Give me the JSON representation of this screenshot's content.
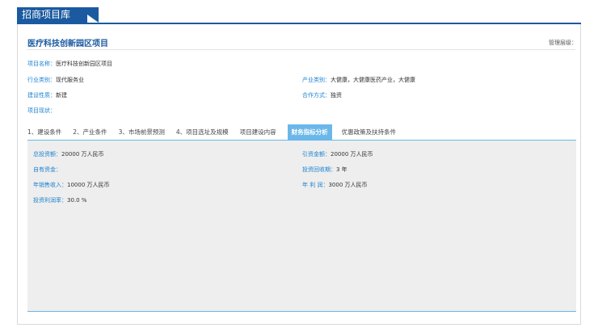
{
  "header": {
    "title": "招商项目库"
  },
  "project": {
    "title": "医疗科技创新园区项目",
    "management_label": "管理层级："
  },
  "fields": {
    "name": {
      "label": "项目名称：",
      "value": "医疗科技创新园区项目"
    },
    "industry": {
      "label": "行业类别：",
      "value": "现代服务业"
    },
    "product": {
      "label": "产业类别：",
      "value": "大健康，大健康医药产业，大健康"
    },
    "nature": {
      "label": "建设性质：",
      "value": "新建"
    },
    "coop": {
      "label": "合作方式：",
      "value": "独资"
    },
    "status": {
      "label": "项目现状：",
      "value": ""
    }
  },
  "tabs": [
    {
      "label": "1、建设条件"
    },
    {
      "label": "2、产业条件"
    },
    {
      "label": "3、市场前景预测"
    },
    {
      "label": "4、项目选址及规模"
    },
    {
      "label": "项目建设内容"
    },
    {
      "label": "财务指标分析",
      "active": true
    },
    {
      "label": "优惠政策及扶持条件"
    }
  ],
  "finance": {
    "total_investment": {
      "label": "总投资额：",
      "value": "20000 万人民币"
    },
    "attracted": {
      "label": "引资金额：",
      "value": "20000 万人民币"
    },
    "own_funds": {
      "label": "自有资金：",
      "value": ""
    },
    "payback": {
      "label": "投资回收期：",
      "value": "3 年"
    },
    "annual_sales": {
      "label": "年销售收入：",
      "value": "10000 万人民币"
    },
    "annual_profit": {
      "label": "年 利 润：",
      "value": "3000 万人民币"
    },
    "roi": {
      "label": "投资利润率：",
      "value": "30.0 %"
    }
  },
  "colors": {
    "brand": "#1b5aa0",
    "label": "#1b82d0",
    "active_tab": "#6ab7ea",
    "content_bg": "#eeeeee"
  }
}
